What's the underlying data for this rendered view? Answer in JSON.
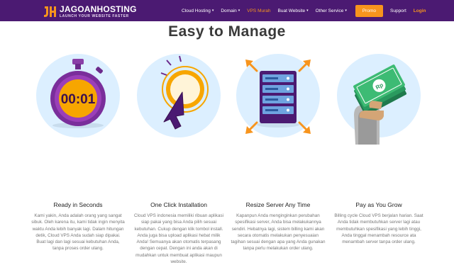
{
  "header": {
    "logo_text": "JAGOANHOSTING",
    "logo_tagline": "LAUNCH YOUR WEBSITE FASTER",
    "nav": [
      {
        "label": "Cloud Hosting",
        "dropdown": true,
        "active": false
      },
      {
        "label": "Domain",
        "dropdown": true,
        "active": false
      },
      {
        "label": "VPS Murah",
        "dropdown": false,
        "active": true
      },
      {
        "label": "Buat Website",
        "dropdown": true,
        "active": false
      },
      {
        "label": "Other Service",
        "dropdown": true,
        "active": false
      }
    ],
    "promo_label": "Promo",
    "support_label": "Support",
    "login_label": "Login"
  },
  "section": {
    "title": "Easy to Manage"
  },
  "features": [
    {
      "icon": "stopwatch-icon",
      "timer_text": "00:01",
      "title": "Ready in Seconds",
      "description": "Kami yakin, Anda adalah orang yang sangat sibuk. Oleh karena itu, kami tidak ingin menyita waktu Anda lebih banyak lagi. Dalam hitungan detik, Cloud VPS Anda sudah siap dipakai. Buat lagi dan lagi sesuai kebutuhan Anda, tanpa proses order ulang."
    },
    {
      "icon": "cursor-click-icon",
      "title": "One Click Installation",
      "description": "Cloud VPS indonesia memiliki ribuan aplikasi siap pakai yang bisa Anda pilih sesuai kebutuhan. Cukup dengan klik tombol install. Anda juga bisa upload aplikasi hebat milik Anda! Semuanya akan otomatis terpasang dengan cepat. Dengan ini anda akan di mudahkan untuk membuat aplikasi maupun website."
    },
    {
      "icon": "server-resize-icon",
      "title": "Resize Server Any Time",
      "description": "Kapanpun Anda menginginkan perubahan spesifikasi server, Anda bisa melakukannya sendiri. Hebatnya lagi, sistem billing kami akan secara otomatis melakukan penyesuaian tagihan sesuai dengan apa yang Anda gunakan tanpa perlu melakukan order ulang."
    },
    {
      "icon": "money-hand-icon",
      "money_label": "Rp",
      "title": "Pay as You Grow",
      "description": "Billing cycle Cloud VPS berjalan harian. Saat Anda tidak membutuhkan server lagi atau membutuhkan spesifikasi yang lebih tinggi, Anda tinggal menambah resource ata menambah server tanpa order ulang."
    }
  ],
  "colors": {
    "navbar": "#4b1a72",
    "accent": "#f7941d",
    "circle": "#dcefff",
    "icon_purple": "#4b1a72"
  }
}
